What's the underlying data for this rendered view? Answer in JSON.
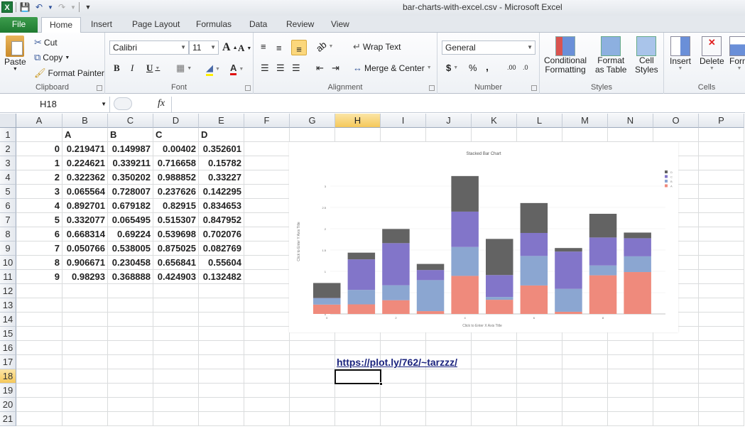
{
  "window": {
    "title": "bar-charts-with-excel.csv  -  Microsoft Excel"
  },
  "qat": {
    "icons": [
      "excel-logo",
      "save-icon",
      "undo-icon",
      "redo-icon",
      "customize-icon"
    ]
  },
  "tabs": [
    "File",
    "Home",
    "Insert",
    "Page Layout",
    "Formulas",
    "Data",
    "Review",
    "View"
  ],
  "active_tab": "Home",
  "ribbon": {
    "clipboard": {
      "label": "Clipboard",
      "paste": "Paste",
      "cut": "Cut",
      "copy": "Copy",
      "format_painter": "Format Painter"
    },
    "font": {
      "label": "Font",
      "name": "Calibri",
      "size": "11",
      "bold": "B",
      "italic": "I",
      "underline": "U",
      "grow": "A",
      "shrink": "A"
    },
    "alignment": {
      "label": "Alignment",
      "wrap_text": "Wrap Text",
      "merge_center": "Merge & Center"
    },
    "number": {
      "label": "Number",
      "format": "General",
      "currency": "$",
      "percent": "%",
      "comma": ",",
      "inc_decimal": ".00",
      "dec_decimal": ".0"
    },
    "styles": {
      "label": "Styles",
      "conditional": [
        "Conditional",
        "Formatting"
      ],
      "format_table": [
        "Format",
        "as Table"
      ],
      "cell_styles": [
        "Cell",
        "Styles"
      ]
    },
    "cells": {
      "label": "Cells",
      "insert": "Insert",
      "delete": "Delete",
      "format": "Form"
    }
  },
  "formula_bar": {
    "name_box": "H18",
    "fx": "fx",
    "value": ""
  },
  "sheet": {
    "columns": [
      "A",
      "B",
      "C",
      "D",
      "E",
      "F",
      "G",
      "H",
      "I",
      "J",
      "K",
      "L",
      "M",
      "N",
      "O",
      "P"
    ],
    "selected_column": "H",
    "rows": [
      "1",
      "2",
      "3",
      "4",
      "5",
      "6",
      "7",
      "8",
      "9",
      "10",
      "11",
      "12",
      "13",
      "14",
      "15",
      "16",
      "17",
      "18",
      "19",
      "20",
      "21"
    ],
    "selected_row": "18",
    "header_row": [
      "",
      "A",
      "B",
      "C",
      "D"
    ],
    "data": [
      [
        "0",
        "0.219471",
        "0.149987",
        "0.00402",
        "0.352601"
      ],
      [
        "1",
        "0.224621",
        "0.339211",
        "0.716658",
        "0.15782"
      ],
      [
        "2",
        "0.322362",
        "0.350202",
        "0.988852",
        "0.33227"
      ],
      [
        "3",
        "0.065564",
        "0.728007",
        "0.237626",
        "0.142295"
      ],
      [
        "4",
        "0.892701",
        "0.679182",
        "0.82915",
        "0.834653"
      ],
      [
        "5",
        "0.332077",
        "0.065495",
        "0.515307",
        "0.847952"
      ],
      [
        "6",
        "0.668314",
        "0.69224",
        "0.539698",
        "0.702076"
      ],
      [
        "7",
        "0.050766",
        "0.538005",
        "0.875025",
        "0.082769"
      ],
      [
        "8",
        "0.906671",
        "0.230458",
        "0.656841",
        "0.55604"
      ],
      [
        "9",
        "0.98293",
        "0.368888",
        "0.424903",
        "0.132482"
      ]
    ],
    "link_cell": {
      "ref": "H17",
      "text": "https://plot.ly/762/~tarzzz/"
    },
    "active_cell": "H18"
  },
  "chart_data": {
    "type": "bar",
    "stacked": true,
    "title": "Stacked Bar Chart",
    "xlabel": "Click to Enter X Axis Title",
    "ylabel": "Click to Enter Y Axis Title",
    "categories": [
      "0",
      "1",
      "2",
      "3",
      "4",
      "5",
      "6",
      "7",
      "8",
      "9"
    ],
    "x_tick_labels": [
      "0",
      "2",
      "4",
      "6",
      "8"
    ],
    "ylim": [
      0,
      3.3
    ],
    "y_ticks": [
      "0",
      "0.5",
      "1",
      "1.5",
      "2",
      "2.5",
      "3"
    ],
    "grid": true,
    "legend": "top-right",
    "series": [
      {
        "name": "A",
        "color": "#ef8a7c",
        "values": [
          0.219471,
          0.224621,
          0.322362,
          0.065564,
          0.892701,
          0.332077,
          0.668314,
          0.050766,
          0.906671,
          0.98293
        ]
      },
      {
        "name": "B",
        "color": "#8ba6d1",
        "values": [
          0.149987,
          0.339211,
          0.350202,
          0.728007,
          0.679182,
          0.065495,
          0.69224,
          0.538005,
          0.230458,
          0.368888
        ]
      },
      {
        "name": "C",
        "color": "#8275c9",
        "values": [
          0.00402,
          0.716658,
          0.988852,
          0.237626,
          0.82915,
          0.515307,
          0.539698,
          0.875025,
          0.656841,
          0.424903
        ]
      },
      {
        "name": "D",
        "color": "#636363",
        "values": [
          0.352601,
          0.15782,
          0.33227,
          0.142295,
          0.834653,
          0.847952,
          0.702076,
          0.082769,
          0.55604,
          0.132482
        ]
      }
    ]
  }
}
